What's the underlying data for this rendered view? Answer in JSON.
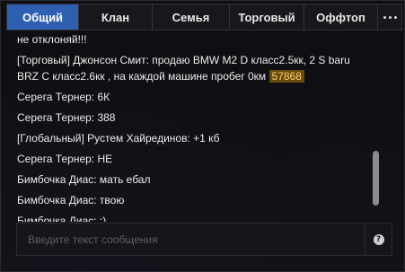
{
  "tabs": [
    {
      "label": "Общий",
      "active": true
    },
    {
      "label": "Клан",
      "active": false
    },
    {
      "label": "Семья",
      "active": false
    },
    {
      "label": "Торговый",
      "active": false
    },
    {
      "label": "Оффтоп",
      "active": false
    }
  ],
  "more_icon": "more-dots-icon",
  "messages": [
    {
      "text": "не отклоняй!!!"
    },
    {
      "text": "[Торговый] Джонсон Смит: продаю BMW M2 D класс2.5кк, 2 S baru BRZ C класс2.6кк , на каждой машине пробег 0км ",
      "tag": "57868"
    },
    {
      "text": "Серега Тернер: 6К"
    },
    {
      "text": "Серега Тернер: 388"
    },
    {
      "text": "[Глобальный] Рустем Хайрединов: +1 кб"
    },
    {
      "text": "Серега Тернер: НЕ"
    },
    {
      "text": "Бимбочка Диас: мать ебал"
    },
    {
      "text": "Бимбочка Диас: твою"
    },
    {
      "text": "Бимбочка Диас: :)"
    }
  ],
  "input": {
    "placeholder": "Введите текст сообщения",
    "value": ""
  },
  "help_icon_glyph": "?",
  "colors": {
    "active_tab": "#2f5fb0",
    "tag_background": "#6b4a10",
    "tag_text": "#ffd36b"
  }
}
